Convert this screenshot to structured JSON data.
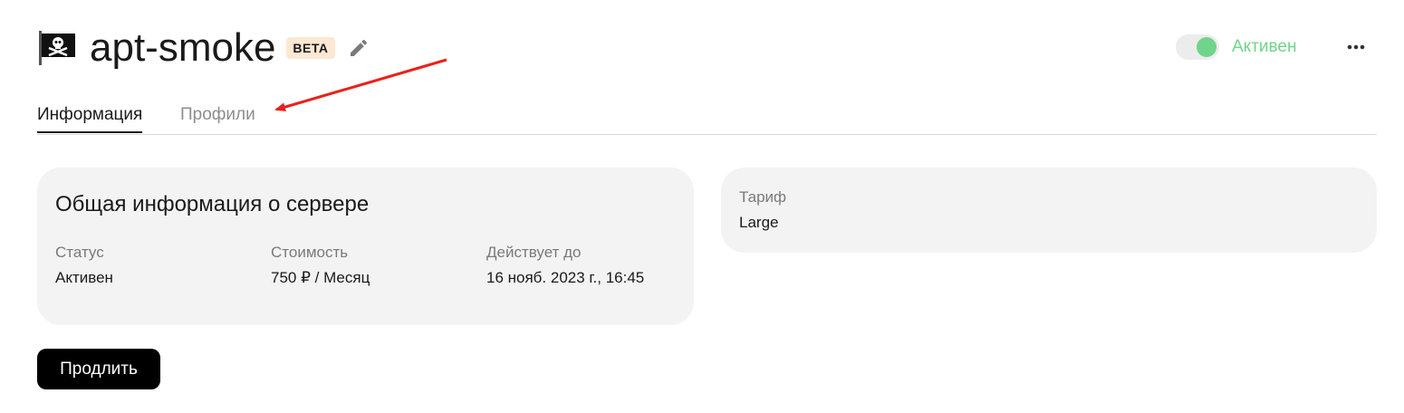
{
  "header": {
    "title": "apt-smoke",
    "badge": "BETA",
    "flag_icon": "pirate-flag-icon",
    "edit_icon": "pencil-icon"
  },
  "status": {
    "label": "Активен",
    "enabled": true,
    "color": "#6fd58a"
  },
  "more_icon": "more-dots-icon",
  "tabs": [
    {
      "label": "Информация",
      "active": true
    },
    {
      "label": "Профили",
      "active": false
    }
  ],
  "general": {
    "title": "Общая информация о сервере",
    "fields": {
      "status": {
        "label": "Статус",
        "value": "Активен"
      },
      "cost": {
        "label": "Стоимость",
        "value": "750 ₽ / Месяц"
      },
      "valid_until": {
        "label": "Действует до",
        "value": "16 нояб. 2023 г., 16:45"
      }
    }
  },
  "tariff": {
    "label": "Тариф",
    "value": "Large"
  },
  "actions": {
    "renew_label": "Продлить"
  },
  "annotation": {
    "arrow_color": "#e8211c"
  }
}
